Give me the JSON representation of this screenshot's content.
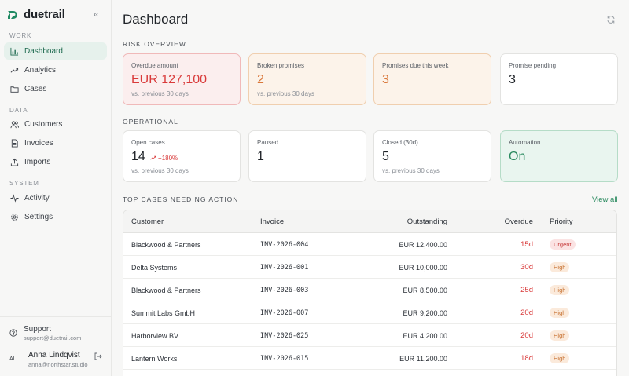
{
  "brand": {
    "name": "duetrail"
  },
  "sidebar": {
    "sections": [
      {
        "label": "WORK",
        "items": [
          {
            "label": "Dashboard",
            "icon": "bar-chart-icon",
            "active": true
          },
          {
            "label": "Analytics",
            "icon": "trend-up-icon"
          },
          {
            "label": "Cases",
            "icon": "folder-icon"
          }
        ]
      },
      {
        "label": "DATA",
        "items": [
          {
            "label": "Customers",
            "icon": "users-icon"
          },
          {
            "label": "Invoices",
            "icon": "document-icon"
          },
          {
            "label": "Imports",
            "icon": "upload-icon"
          }
        ]
      },
      {
        "label": "SYSTEM",
        "items": [
          {
            "label": "Activity",
            "icon": "activity-icon"
          },
          {
            "label": "Settings",
            "icon": "gear-icon"
          }
        ]
      }
    ],
    "support": {
      "title": "Support",
      "email": "support@duetrail.com"
    },
    "user": {
      "initials": "AL",
      "name": "Anna Lindqvist",
      "email": "anna@northstar.studio"
    }
  },
  "header": {
    "title": "Dashboard"
  },
  "risk": {
    "label": "RISK OVERVIEW",
    "cards": [
      {
        "label": "Overdue amount",
        "value": "EUR 127,100",
        "sub": "vs. previous 30 days",
        "tone": "red"
      },
      {
        "label": "Broken promises",
        "value": "2",
        "sub": "vs. previous 30 days",
        "tone": "orange"
      },
      {
        "label": "Promises due this week",
        "value": "3",
        "sub": "",
        "tone": "orange"
      },
      {
        "label": "Promise pending",
        "value": "3",
        "sub": "",
        "tone": "neutral"
      }
    ]
  },
  "operational": {
    "label": "OPERATIONAL",
    "cards": [
      {
        "label": "Open cases",
        "value": "14",
        "trend": "+180%",
        "sub": "vs. previous 30 days"
      },
      {
        "label": "Paused",
        "value": "1",
        "sub": ""
      },
      {
        "label": "Closed (30d)",
        "value": "5",
        "sub": "vs. previous 30 days"
      },
      {
        "label": "Automation",
        "value": "On",
        "sub": "",
        "tone": "green"
      }
    ]
  },
  "cases": {
    "label": "TOP CASES NEEDING ACTION",
    "view_all": "View all",
    "columns": [
      "Customer",
      "Invoice",
      "Outstanding",
      "Overdue",
      "Priority"
    ],
    "rows": [
      {
        "customer": "Blackwood & Partners",
        "invoice": "INV-2026-004",
        "outstanding": "EUR 12,400.00",
        "overdue": "15d",
        "priority": "Urgent"
      },
      {
        "customer": "Delta Systems",
        "invoice": "INV-2026-001",
        "outstanding": "EUR 10,000.00",
        "overdue": "30d",
        "priority": "High"
      },
      {
        "customer": "Blackwood & Partners",
        "invoice": "INV-2026-003",
        "outstanding": "EUR 8,500.00",
        "overdue": "25d",
        "priority": "High"
      },
      {
        "customer": "Summit Labs GmbH",
        "invoice": "INV-2026-007",
        "outstanding": "EUR 9,200.00",
        "overdue": "20d",
        "priority": "High"
      },
      {
        "customer": "Harborview BV",
        "invoice": "INV-2026-025",
        "outstanding": "EUR 4,200.00",
        "overdue": "20d",
        "priority": "High"
      },
      {
        "customer": "Lantern Works",
        "invoice": "INV-2026-015",
        "outstanding": "EUR 11,200.00",
        "overdue": "18d",
        "priority": "High"
      }
    ]
  },
  "colors": {
    "accent": "#2a8a5f",
    "danger": "#d93a3a",
    "warning": "#d9773a"
  }
}
